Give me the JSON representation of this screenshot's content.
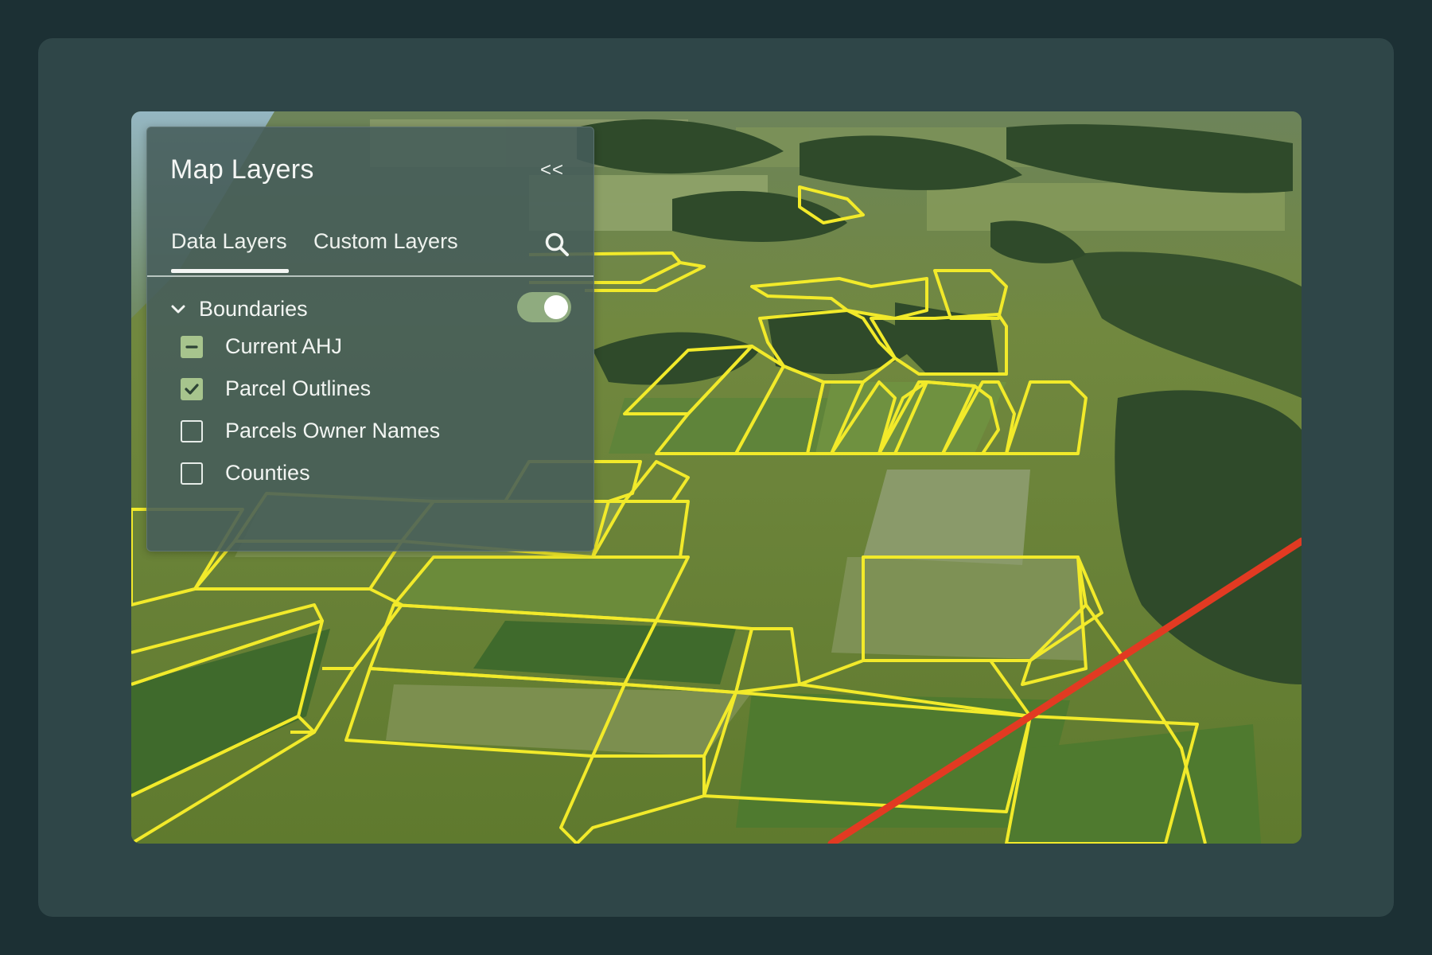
{
  "panel": {
    "title": "Map Layers",
    "collapse_label": "<<",
    "tabs": [
      {
        "label": "Data Layers",
        "active": true
      },
      {
        "label": "Custom Layers",
        "active": false
      }
    ],
    "search_icon": "search-icon",
    "group": {
      "label": "Boundaries",
      "expanded": true,
      "enabled": true
    },
    "layers": [
      {
        "label": "Current AHJ",
        "state": "indeterminate"
      },
      {
        "label": "Parcel Outlines",
        "state": "checked"
      },
      {
        "label": "Parcels Owner Names",
        "state": "unchecked"
      },
      {
        "label": "Counties",
        "state": "unchecked"
      }
    ]
  },
  "colors": {
    "background": "#1c3034",
    "card": "#2f4648",
    "panel": "#465c5a",
    "toggle_on": "#8fab7f",
    "checkbox_checked": "#a7c48d",
    "parcel_outline": "#f2ea2a",
    "boundary_line": "#e23a22"
  }
}
